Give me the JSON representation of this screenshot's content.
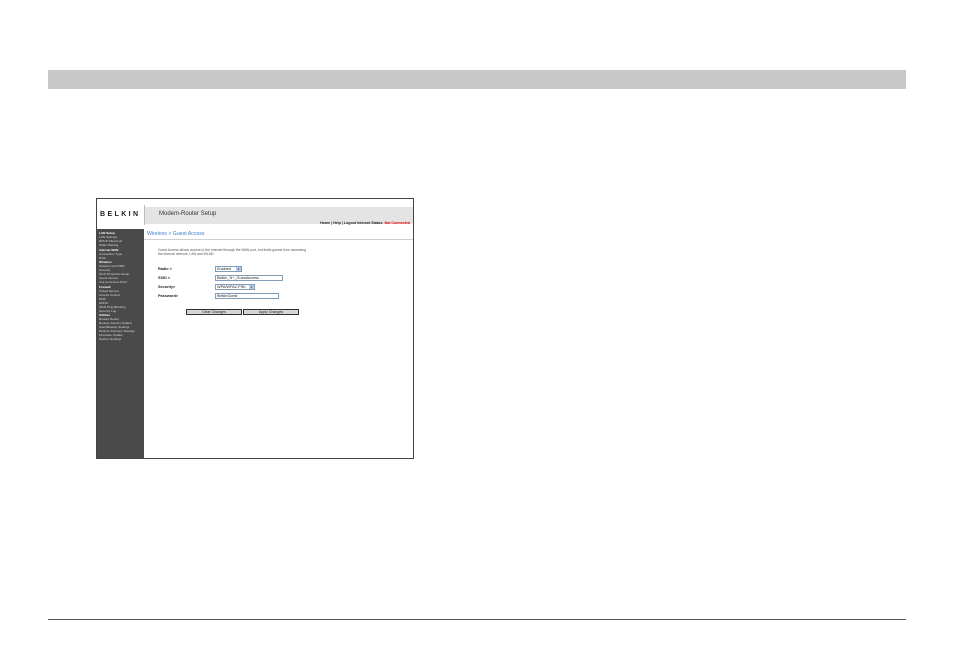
{
  "screenshot": {
    "logo": "BELKIN",
    "header_title": "Modem-Router Setup",
    "header_links": {
      "home": "Home",
      "help": "Help",
      "logout": "Logout",
      "status_label": "Internet Status:",
      "status_value": "Not Connected",
      "sep": "|"
    },
    "sidebar": [
      {
        "label": "LAN Setup",
        "category": true
      },
      {
        "label": "LAN Settings",
        "category": false
      },
      {
        "label": "DHCP Client List",
        "category": false
      },
      {
        "label": "Static Routing",
        "category": false
      },
      {
        "label": "Internet WAN",
        "category": true
      },
      {
        "label": "Connection Type",
        "category": false
      },
      {
        "label": "DNS",
        "category": false
      },
      {
        "label": "Wireless",
        "category": true
      },
      {
        "label": "Channel and SSID",
        "category": false
      },
      {
        "label": "Security",
        "category": false
      },
      {
        "label": "Wi-Fi Protected Setup",
        "category": false
      },
      {
        "label": "Guest Access",
        "category": false
      },
      {
        "label": "Use as Access Point",
        "category": false
      },
      {
        "label": "Firewall",
        "category": true
      },
      {
        "label": "Virtual Servers",
        "category": false
      },
      {
        "label": "Access Control",
        "category": false
      },
      {
        "label": "DMZ",
        "category": false
      },
      {
        "label": "DDNS",
        "category": false
      },
      {
        "label": "WAN Ping Blocking",
        "category": false
      },
      {
        "label": "Security Log",
        "category": false
      },
      {
        "label": "Utilities",
        "category": true
      },
      {
        "label": "Restart Router",
        "category": false
      },
      {
        "label": "Restore Factory Default",
        "category": false
      },
      {
        "label": "Save/Backup Settings",
        "category": false
      },
      {
        "label": "Restore Previous Settings",
        "category": false
      },
      {
        "label": "Firmware Update",
        "category": false
      },
      {
        "label": "System Settings",
        "category": false
      }
    ],
    "breadcrumb": "Wireless > Guest Access",
    "description": "Guest Access allows access to the Internet through the WAN port, but limits guests from accessing the internal network, LAN and WLAN",
    "form": {
      "radio_label": "Radio >",
      "radio_value": "Enabled",
      "ssid_label": "SSID >",
      "ssid_value": "Belkin_N+_GuestAccess",
      "security_label": "Security>",
      "security_value": "WPA/WPA2-PSK",
      "password_label": "Password>",
      "password_value": "BelkinGuest"
    },
    "buttons": {
      "clear": "Clear Changes",
      "apply": "Apply Changes"
    }
  }
}
